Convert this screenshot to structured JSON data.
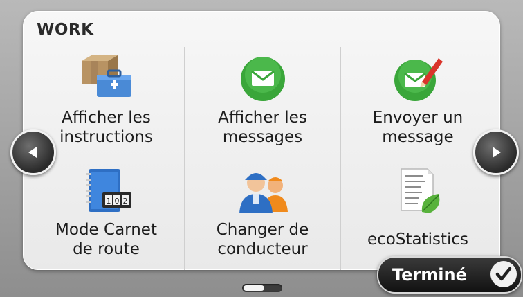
{
  "panel": {
    "title": "WORK"
  },
  "menu": {
    "items": [
      {
        "label": "Afficher les\ninstructions",
        "icon": "toolbox-package-icon"
      },
      {
        "label": "Afficher les\nmessages",
        "icon": "envelope-icon"
      },
      {
        "label": "Envoyer un\nmessage",
        "icon": "envelope-pencil-icon"
      },
      {
        "label": "Mode Carnet\nde route",
        "icon": "logbook-icon"
      },
      {
        "label": "Changer de\nconducteur",
        "icon": "drivers-icon"
      },
      {
        "label": "ecoStatistics",
        "icon": "eco-statistics-icon"
      }
    ]
  },
  "nav": {
    "prev_icon": "arrow-left-icon",
    "next_icon": "arrow-right-icon"
  },
  "done_button": {
    "label": "Terminé",
    "icon": "checkmark-icon"
  },
  "colors": {
    "accent_green": "#3aa63a",
    "dark": "#1f1f1f",
    "blue": "#2e6fc4"
  }
}
